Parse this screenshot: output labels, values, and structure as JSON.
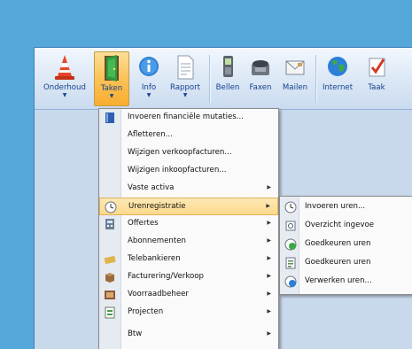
{
  "toolbar": {
    "buttons": [
      {
        "label": "Onderhoud",
        "icon": "traffic-cone-icon"
      },
      {
        "label": "Taken",
        "icon": "door-icon"
      },
      {
        "label": "Info",
        "icon": "info-icon"
      },
      {
        "label": "Rapport",
        "icon": "report-icon"
      },
      {
        "label": "Bellen",
        "icon": "phone-icon"
      },
      {
        "label": "Faxen",
        "icon": "fax-icon"
      },
      {
        "label": "Mailen",
        "icon": "mail-icon"
      },
      {
        "label": "Internet",
        "icon": "globe-icon"
      },
      {
        "label": "Taak",
        "icon": "task-check-icon"
      }
    ]
  },
  "menu": {
    "items": [
      {
        "label": "Invoeren financiële mutaties...",
        "icon": "book-icon"
      },
      {
        "label": "Afletteren..."
      },
      {
        "label": "Wijzigen verkoopfacturen..."
      },
      {
        "label": "Wijzigen inkoopfacturen..."
      },
      {
        "label": "Vaste activa"
      },
      {
        "label": "Urenregistratie",
        "icon": "clock-icon"
      },
      {
        "label": "Offertes",
        "icon": "calculator-icon"
      },
      {
        "label": "Abonnementen"
      },
      {
        "label": "Telebankieren",
        "icon": "bank-card-icon"
      },
      {
        "label": "Facturering/Verkoop",
        "icon": "box-icon"
      },
      {
        "label": "Voorraadbeheer",
        "icon": "stock-icon"
      },
      {
        "label": "Projecten",
        "icon": "project-icon"
      },
      {
        "label": "Btw"
      }
    ]
  },
  "submenu": {
    "items": [
      {
        "label": "Invoeren uren...",
        "icon": "clock-icon"
      },
      {
        "label": "Overzicht ingevoe",
        "icon": "overview-icon"
      },
      {
        "label": "Goedkeuren uren",
        "icon": "approve-icon"
      },
      {
        "label": "Goedkeuren uren",
        "icon": "approve-list-icon"
      },
      {
        "label": "Verwerken uren...",
        "icon": "process-icon"
      }
    ]
  },
  "colors": {
    "background": "#54a9da",
    "highlight": "#fbd98a",
    "ribbon_text": "#15428b"
  }
}
